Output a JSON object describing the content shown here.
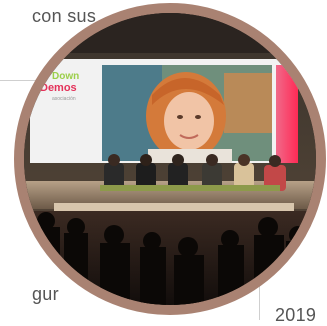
{
  "article": {
    "snippet_top": "con sus",
    "snippet_bottom_left": "gur",
    "snippet_bottom_right": "2019"
  },
  "photo": {
    "border_color": "#a98272",
    "screen_logo": {
      "line1": "Down",
      "line2": "Demos",
      "line3": "asociación"
    }
  }
}
